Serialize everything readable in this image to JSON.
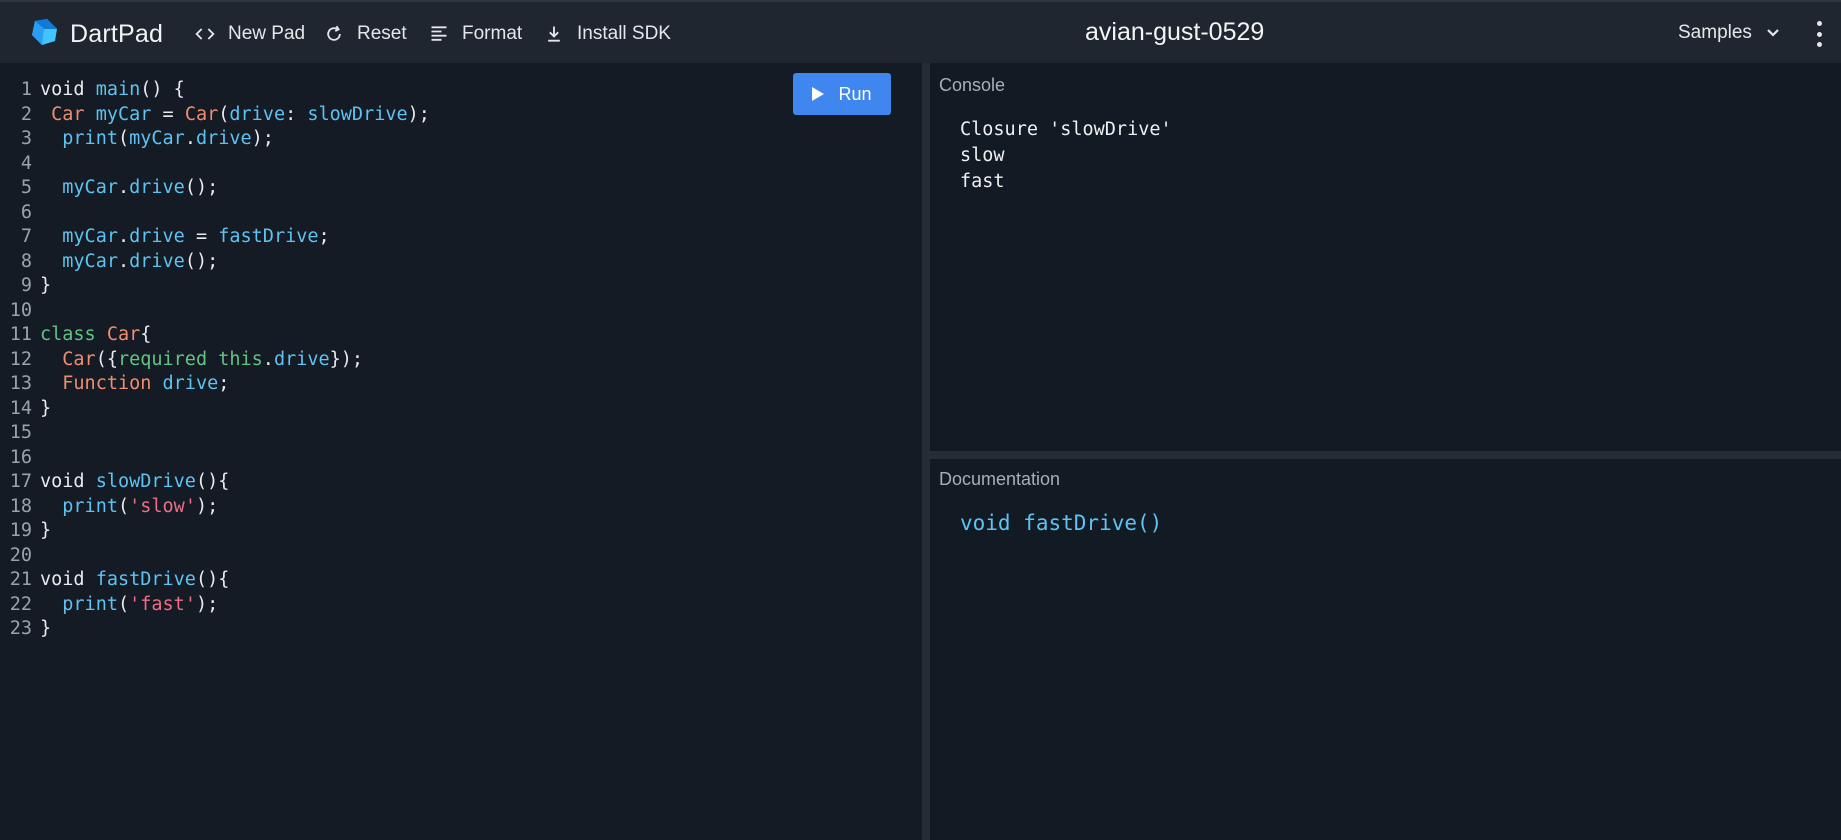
{
  "app": {
    "name": "DartPad",
    "pad_title": "avian-gust-0529"
  },
  "toolbar": {
    "new_pad_label": "New Pad",
    "reset_label": "Reset",
    "format_label": "Format",
    "install_sdk_label": "Install SDK",
    "samples_label": "Samples"
  },
  "editor": {
    "run_label": "Run",
    "lines": [
      {
        "n": "1",
        "tokens": [
          [
            "kw",
            "void "
          ],
          [
            "fn",
            "main"
          ],
          [
            "plain",
            "() {"
          ]
        ]
      },
      {
        "n": "2",
        "tokens": [
          [
            "plain",
            " "
          ],
          [
            "cls",
            "Car "
          ],
          [
            "fn",
            "myCar"
          ],
          [
            "plain",
            " = "
          ],
          [
            "cls",
            "Car"
          ],
          [
            "plain",
            "("
          ],
          [
            "fn",
            "drive"
          ],
          [
            "plain",
            ": "
          ],
          [
            "fn",
            "slowDrive"
          ],
          [
            "plain",
            ");"
          ]
        ]
      },
      {
        "n": "3",
        "tokens": [
          [
            "plain",
            "  "
          ],
          [
            "fn",
            "print"
          ],
          [
            "plain",
            "("
          ],
          [
            "fn",
            "myCar"
          ],
          [
            "plain",
            "."
          ],
          [
            "fn",
            "drive"
          ],
          [
            "plain",
            ");"
          ]
        ]
      },
      {
        "n": "4",
        "tokens": []
      },
      {
        "n": "5",
        "tokens": [
          [
            "plain",
            "  "
          ],
          [
            "fn",
            "myCar"
          ],
          [
            "plain",
            "."
          ],
          [
            "fn",
            "drive"
          ],
          [
            "plain",
            "();"
          ]
        ]
      },
      {
        "n": "6",
        "tokens": []
      },
      {
        "n": "7",
        "tokens": [
          [
            "plain",
            "  "
          ],
          [
            "fn",
            "myCar"
          ],
          [
            "plain",
            "."
          ],
          [
            "fn",
            "drive"
          ],
          [
            "plain",
            " = "
          ],
          [
            "fn",
            "fastDrive"
          ],
          [
            "plain",
            ";"
          ]
        ]
      },
      {
        "n": "8",
        "tokens": [
          [
            "plain",
            "  "
          ],
          [
            "fn",
            "myCar"
          ],
          [
            "plain",
            "."
          ],
          [
            "fn",
            "drive"
          ],
          [
            "plain",
            "();"
          ]
        ]
      },
      {
        "n": "9",
        "tokens": [
          [
            "plain",
            "}"
          ]
        ]
      },
      {
        "n": "10",
        "tokens": []
      },
      {
        "n": "11",
        "tokens": [
          [
            "grn",
            "class "
          ],
          [
            "cls",
            "Car"
          ],
          [
            "plain",
            "{"
          ]
        ]
      },
      {
        "n": "12",
        "tokens": [
          [
            "plain",
            "  "
          ],
          [
            "cls",
            "Car"
          ],
          [
            "plain",
            "({"
          ],
          [
            "grn",
            "required "
          ],
          [
            "grn",
            "this"
          ],
          [
            "plain",
            "."
          ],
          [
            "fn",
            "drive"
          ],
          [
            "plain",
            "});"
          ]
        ]
      },
      {
        "n": "13",
        "tokens": [
          [
            "plain",
            "  "
          ],
          [
            "cls",
            "Function "
          ],
          [
            "fn",
            "drive"
          ],
          [
            "plain",
            ";"
          ]
        ]
      },
      {
        "n": "14",
        "tokens": [
          [
            "plain",
            "}"
          ]
        ]
      },
      {
        "n": "15",
        "tokens": []
      },
      {
        "n": "16",
        "tokens": []
      },
      {
        "n": "17",
        "tokens": [
          [
            "kw",
            "void "
          ],
          [
            "fn",
            "slowDrive"
          ],
          [
            "plain",
            "(){"
          ]
        ]
      },
      {
        "n": "18",
        "tokens": [
          [
            "plain",
            "  "
          ],
          [
            "fn",
            "print"
          ],
          [
            "plain",
            "("
          ],
          [
            "str",
            "'slow'"
          ],
          [
            "plain",
            ");"
          ]
        ]
      },
      {
        "n": "19",
        "tokens": [
          [
            "plain",
            "}"
          ]
        ]
      },
      {
        "n": "20",
        "tokens": []
      },
      {
        "n": "21",
        "tokens": [
          [
            "kw",
            "void "
          ],
          [
            "fn",
            "fastDrive"
          ],
          [
            "plain",
            "(){"
          ]
        ]
      },
      {
        "n": "22",
        "tokens": [
          [
            "plain",
            "  "
          ],
          [
            "fn",
            "print"
          ],
          [
            "plain",
            "("
          ],
          [
            "str",
            "'fast'"
          ],
          [
            "plain",
            ");"
          ]
        ]
      },
      {
        "n": "23",
        "tokens": [
          [
            "plain",
            "}"
          ]
        ]
      }
    ]
  },
  "console": {
    "label": "Console",
    "output": [
      "Closure 'slowDrive'",
      "slow",
      "fast"
    ]
  },
  "documentation": {
    "label": "Documentation",
    "signature": "void fastDrive()"
  },
  "colors": {
    "accent": "#3f86ee",
    "topbar": "#1f262f",
    "background": "#121a24",
    "identifier": "#5ec3f2",
    "class": "#f08d6f",
    "keyword_green": "#63c383",
    "string": "#ef6d86"
  },
  "icons": {
    "logo": "dart-logo-icon",
    "new_pad": "code-brackets-icon",
    "reset": "refresh-icon",
    "format": "align-left-icon",
    "install_sdk": "download-icon",
    "samples": "chevron-down-icon",
    "more": "more-vert-icon",
    "run": "play-icon"
  }
}
